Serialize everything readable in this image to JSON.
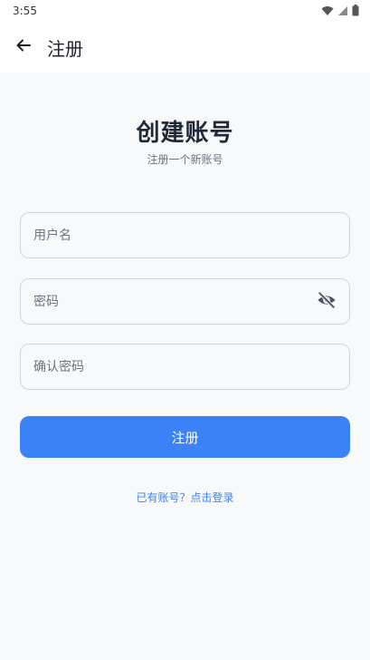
{
  "status_bar": {
    "time": "3:55",
    "icons": [
      "wifi-icon",
      "signal-icon",
      "battery-icon"
    ]
  },
  "app_bar": {
    "title": "注册",
    "back_icon": "arrow-left-icon"
  },
  "form": {
    "heading": "创建账号",
    "subheading": "注册一个新账号",
    "username_placeholder": "用户名",
    "password_placeholder": "密码",
    "confirm_password_placeholder": "确认密码",
    "password_visibility_icon": "eye-off-icon",
    "submit_label": "注册",
    "login_link": "已有账号？点击登录"
  },
  "colors": {
    "primary": "#3b82f6",
    "background": "#f8f9fb",
    "heading": "#1f2937"
  }
}
